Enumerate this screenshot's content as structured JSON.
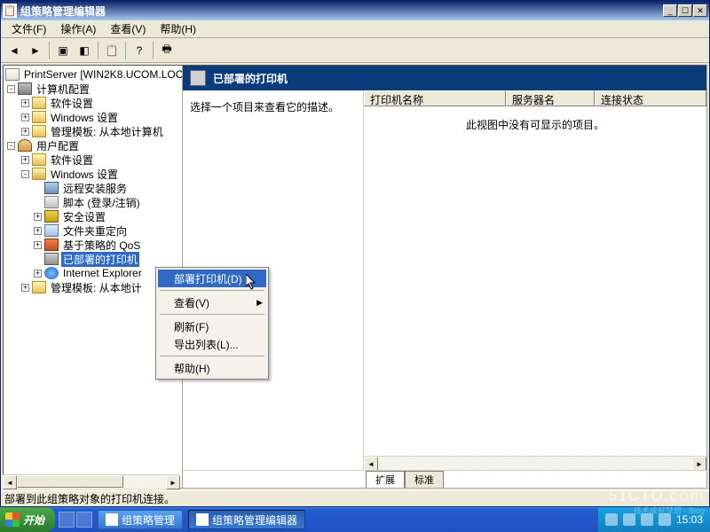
{
  "window": {
    "title": "组策略管理编辑器"
  },
  "menubar": {
    "file": "文件(F)",
    "action": "操作(A)",
    "view": "查看(V)",
    "help": "帮助(H)"
  },
  "tree": {
    "root": "PrintServer [WIN2K8.UCOM.LOC",
    "computer_config": "计算机配置",
    "software_settings": "软件设置",
    "windows_settings": "Windows 设置",
    "admin_templates_local": "管理模板: 从本地计算机",
    "user_config": "用户配置",
    "software_settings2": "软件设置",
    "windows_settings2": "Windows 设置",
    "remote_install": "远程安装服务",
    "scripts": "脚本 (登录/注销)",
    "security_settings": "安全设置",
    "folder_redirect": "文件夹重定向",
    "policy_qos": "基于策略的 QoS",
    "deployed_printers": "已部署的打印机",
    "internet_explorer": "Internet Explorer",
    "admin_templates_local2": "管理模板: 从本地计"
  },
  "detail": {
    "title": "已部署的打印机",
    "desc_prompt": "选择一个项目来查看它的描述。",
    "col_printer": "打印机名称",
    "col_server": "服务器名",
    "col_status": "连接状态",
    "empty_msg": "此视图中没有可显示的项目。",
    "tab_extended": "扩展",
    "tab_standard": "标准"
  },
  "context_menu": {
    "deploy_printer": "部署打印机(D)",
    "view": "查看(V)",
    "refresh": "刷新(F)",
    "export_list": "导出列表(L)...",
    "help": "帮助(H)"
  },
  "statusbar": {
    "text": "部署到此组策略对象的打印机连接。"
  },
  "taskbar": {
    "start": "开始",
    "task1": "组策略管理",
    "task2": "组策略管理编辑器",
    "time": "15:03"
  },
  "watermark": {
    "main": "51CTO.com",
    "sub": "技术成就梦想 - Blog"
  }
}
